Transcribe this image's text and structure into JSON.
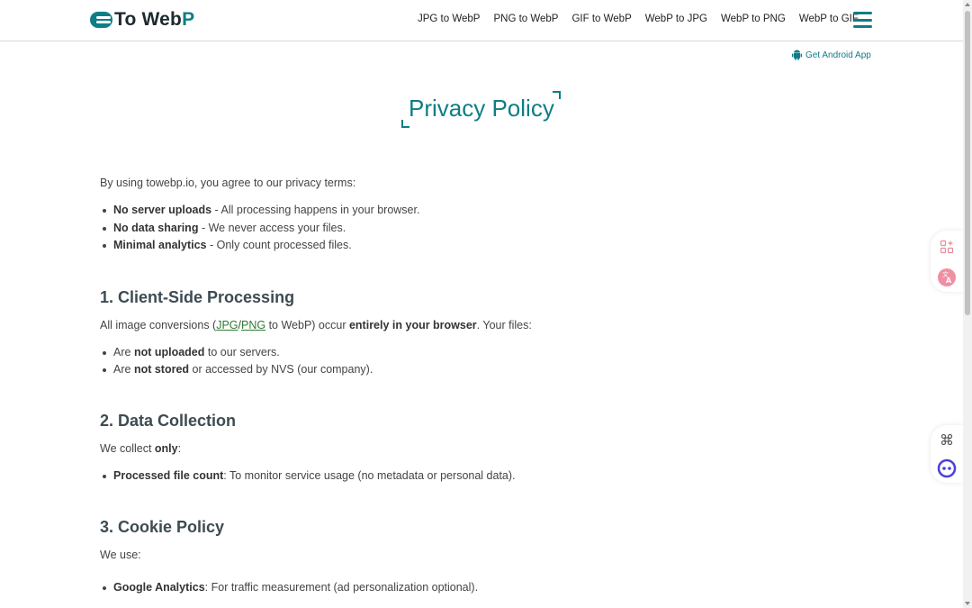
{
  "header": {
    "logo_text": "To Web",
    "logo_text_accent": "P",
    "nav": [
      {
        "label": "JPG to WebP"
      },
      {
        "label": "PNG to WebP"
      },
      {
        "label": "GIF to WebP"
      },
      {
        "label": "WebP to JPG"
      },
      {
        "label": "WebP to PNG"
      },
      {
        "label": "WebP to GIF"
      }
    ],
    "menu_icon": "hamburger-menu-icon"
  },
  "android_link": {
    "label": "Get Android App",
    "icon": "android-icon"
  },
  "page_title": "Privacy Policy",
  "intro": {
    "text": "By using towebp.io, you agree to our privacy terms:",
    "items": [
      {
        "bold": "No server uploads",
        "rest": " - All processing happens in your browser."
      },
      {
        "bold": "No data sharing",
        "rest": " - We never access your files."
      },
      {
        "bold": "Minimal analytics",
        "rest": " - Only count processed files."
      }
    ]
  },
  "section1": {
    "heading": "1. Client-Side Processing",
    "p_prefix": "All image conversions (",
    "link_jpg": "JPG",
    "slash": "/",
    "link_png": "PNG",
    "p_mid": " to WebP) occur ",
    "p_bold": "entirely in your browser",
    "p_suffix": ". Your files:",
    "items": [
      {
        "pre": "Are ",
        "bold": "not uploaded",
        "rest": " to our servers."
      },
      {
        "pre": "Are ",
        "bold": "not stored",
        "rest": " or accessed by NVS (our company)."
      }
    ]
  },
  "section2": {
    "heading": "2. Data Collection",
    "p_prefix": "We collect ",
    "p_bold": "only",
    "p_suffix": ":",
    "items": [
      {
        "bold": "Processed file count",
        "rest": ": To monitor service usage (no metadata or personal data)."
      }
    ]
  },
  "section3": {
    "heading": "3. Cookie Policy",
    "p": "We use:",
    "items": [
      {
        "bold": "Google Analytics",
        "rest": ": For traffic measurement (ad personalization optional)."
      }
    ]
  },
  "colors": {
    "accent": "#0f7d86",
    "link": "#2e7d32",
    "text": "#444444"
  }
}
